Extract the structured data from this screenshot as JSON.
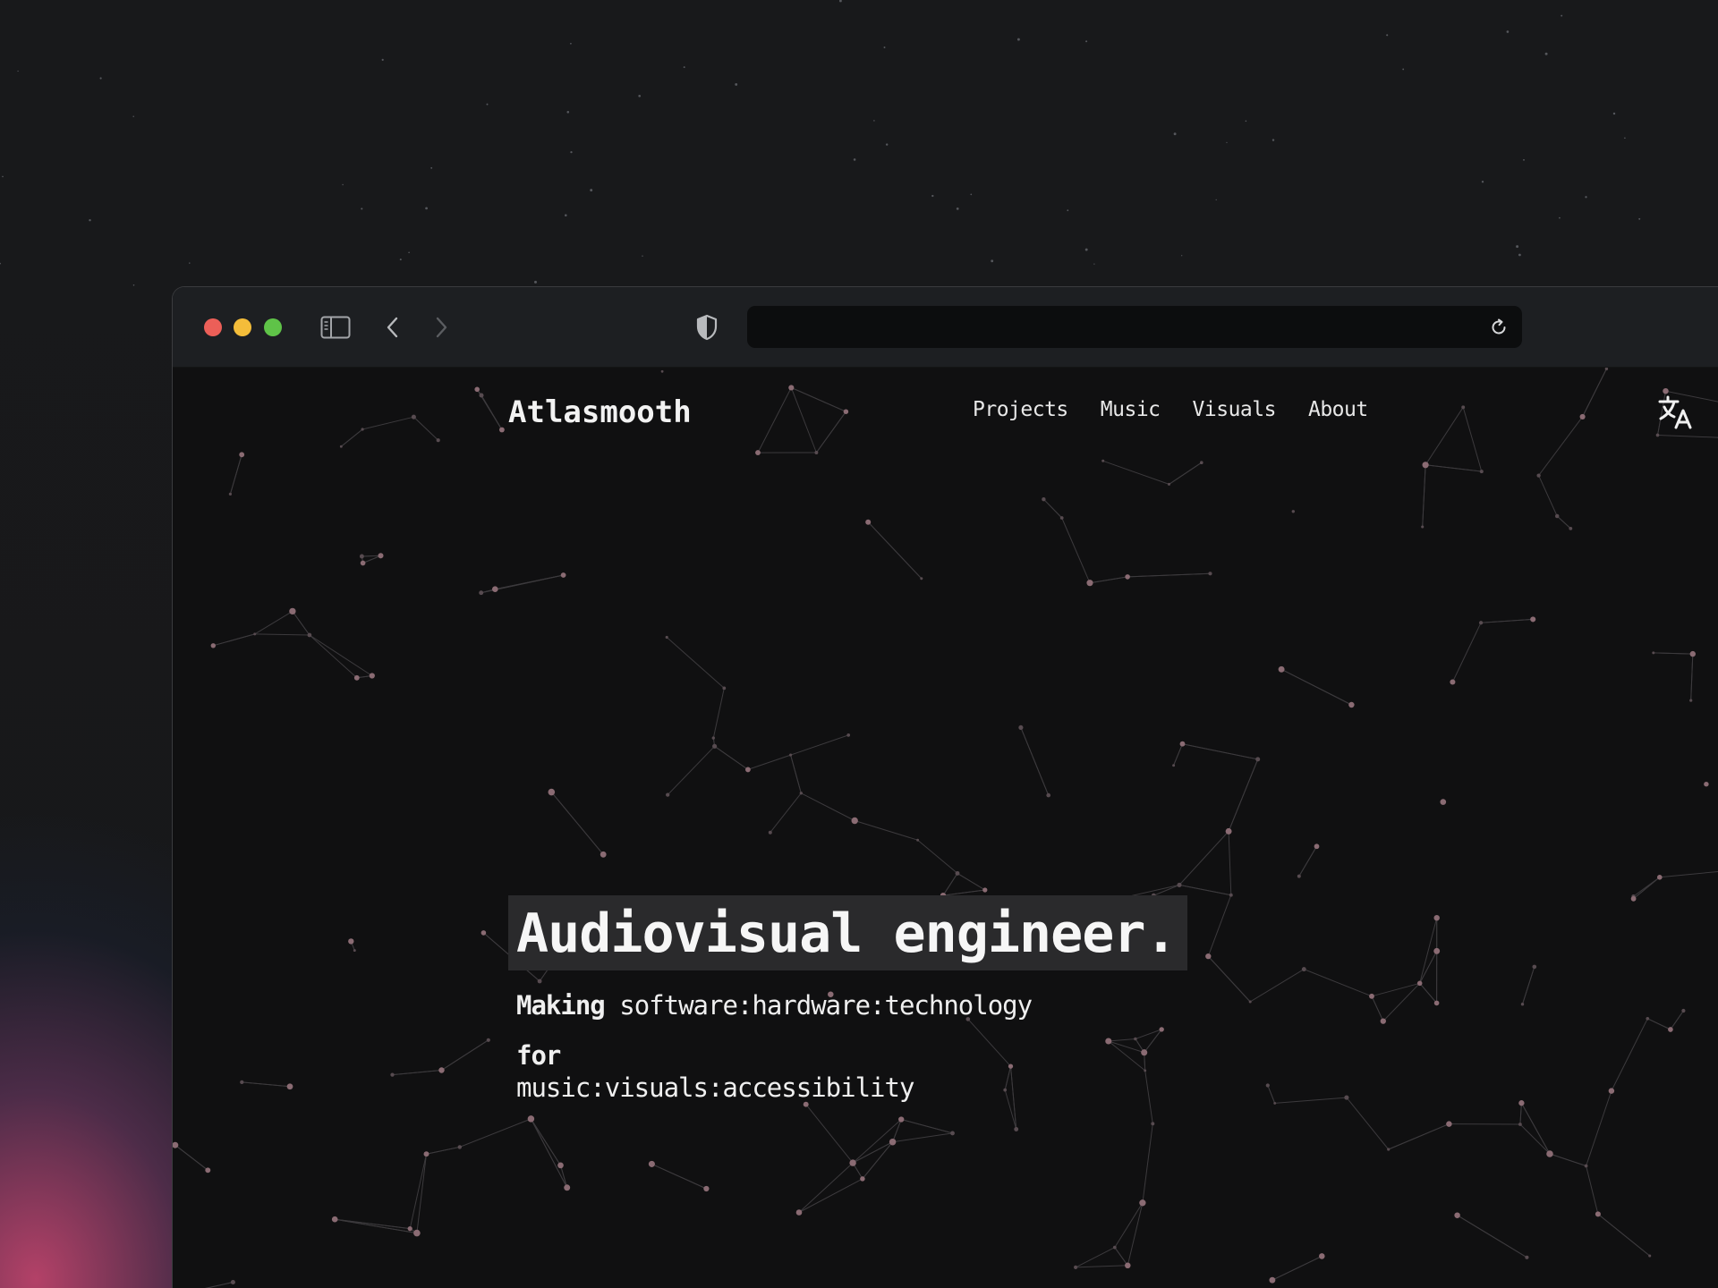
{
  "browser": {
    "url": "",
    "icons": {
      "sidebar": "sidebar-icon",
      "back": "chevron-left-icon",
      "forward": "chevron-right-icon",
      "privacy": "shield-icon",
      "reload": "reload-icon"
    },
    "colors": {
      "close": "#ec5f58",
      "minimize": "#f4bd3a",
      "zoom": "#5fc348",
      "toolbar": "#1d1f22"
    }
  },
  "site": {
    "logo": "Atlasmooth",
    "nav": [
      {
        "label": "Projects"
      },
      {
        "label": "Music"
      },
      {
        "label": "Visuals"
      },
      {
        "label": "About"
      }
    ],
    "translate_icon": "translate-icon",
    "background_color": "#101011",
    "accent_color": "#d08a96"
  },
  "hero": {
    "heading": "Audiovisual engineer.",
    "making_label": "Making",
    "making_items": "software:hardware:technology",
    "for_label": "for",
    "purposes": "music:visuals:accessibility"
  }
}
